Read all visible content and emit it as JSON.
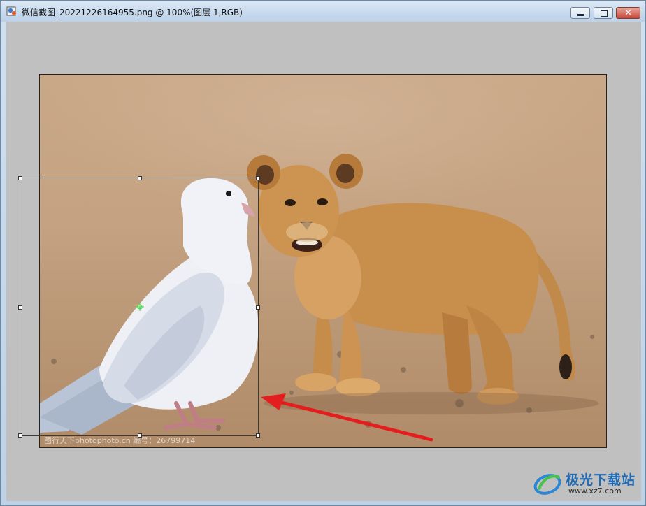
{
  "window": {
    "title": "微信截图_20221226164955.png @ 100%(图层 1,RGB)",
    "buttons": {
      "minimize": "minimize",
      "maximize": "maximize",
      "close": "✕"
    }
  },
  "canvas": {
    "watermark": "图行天下photophoto.cn 编号：26799714"
  },
  "brand": {
    "name": "极光下载站",
    "url": "www.xz7.com"
  }
}
